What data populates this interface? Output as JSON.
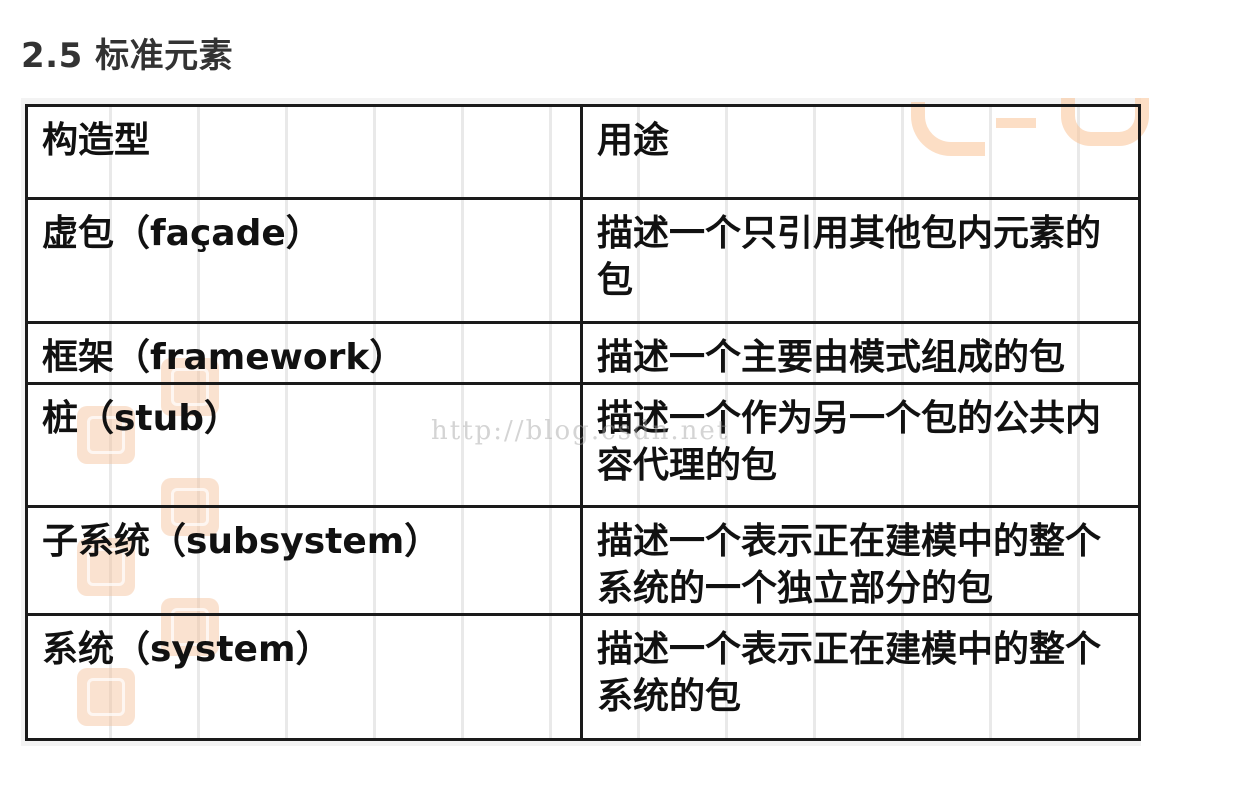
{
  "heading": "2.5 标准元素",
  "watermark": "http://blog.csdn.net",
  "table": {
    "header": [
      "构造型",
      "用途"
    ],
    "rows": [
      {
        "stereotype": "虚包（façade）",
        "usage": "描述一个只引用其他包内元素的包"
      },
      {
        "stereotype": "框架（framework）",
        "usage": "描述一个主要由模式组成的包"
      },
      {
        "stereotype": "桩（stub）",
        "usage": "描述一个作为另一个包的公共内容代理的包"
      },
      {
        "stereotype": "子系统（subsystem）",
        "usage": "描述一个表示正在建模中的整个系统的一个独立部分的包"
      },
      {
        "stereotype": "系统（system）",
        "usage": "描述一个表示正在建模中的整个系统的包"
      }
    ]
  }
}
